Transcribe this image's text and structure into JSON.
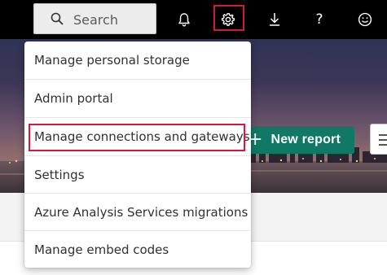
{
  "topbar": {
    "search": {
      "placeholder": "Search",
      "icon": "search-icon"
    },
    "icons": [
      "bell-icon",
      "gear-icon",
      "download-icon",
      "help-icon",
      "smiley-icon"
    ],
    "help_glyph": "?"
  },
  "banner": {
    "new_report_label": "New report",
    "new_report_plus": "+"
  },
  "settings_menu": {
    "items": [
      {
        "label": "Manage personal storage"
      },
      {
        "label": "Admin portal"
      },
      {
        "label": "Manage connections and gateways",
        "highlighted": true
      },
      {
        "label": "Settings"
      },
      {
        "label": "Azure Analysis Services migrations"
      },
      {
        "label": "Manage embed codes"
      }
    ]
  },
  "colors": {
    "topbar_bg": "#000000",
    "accent_green": "#117865",
    "highlight_red": "#d6183a"
  }
}
